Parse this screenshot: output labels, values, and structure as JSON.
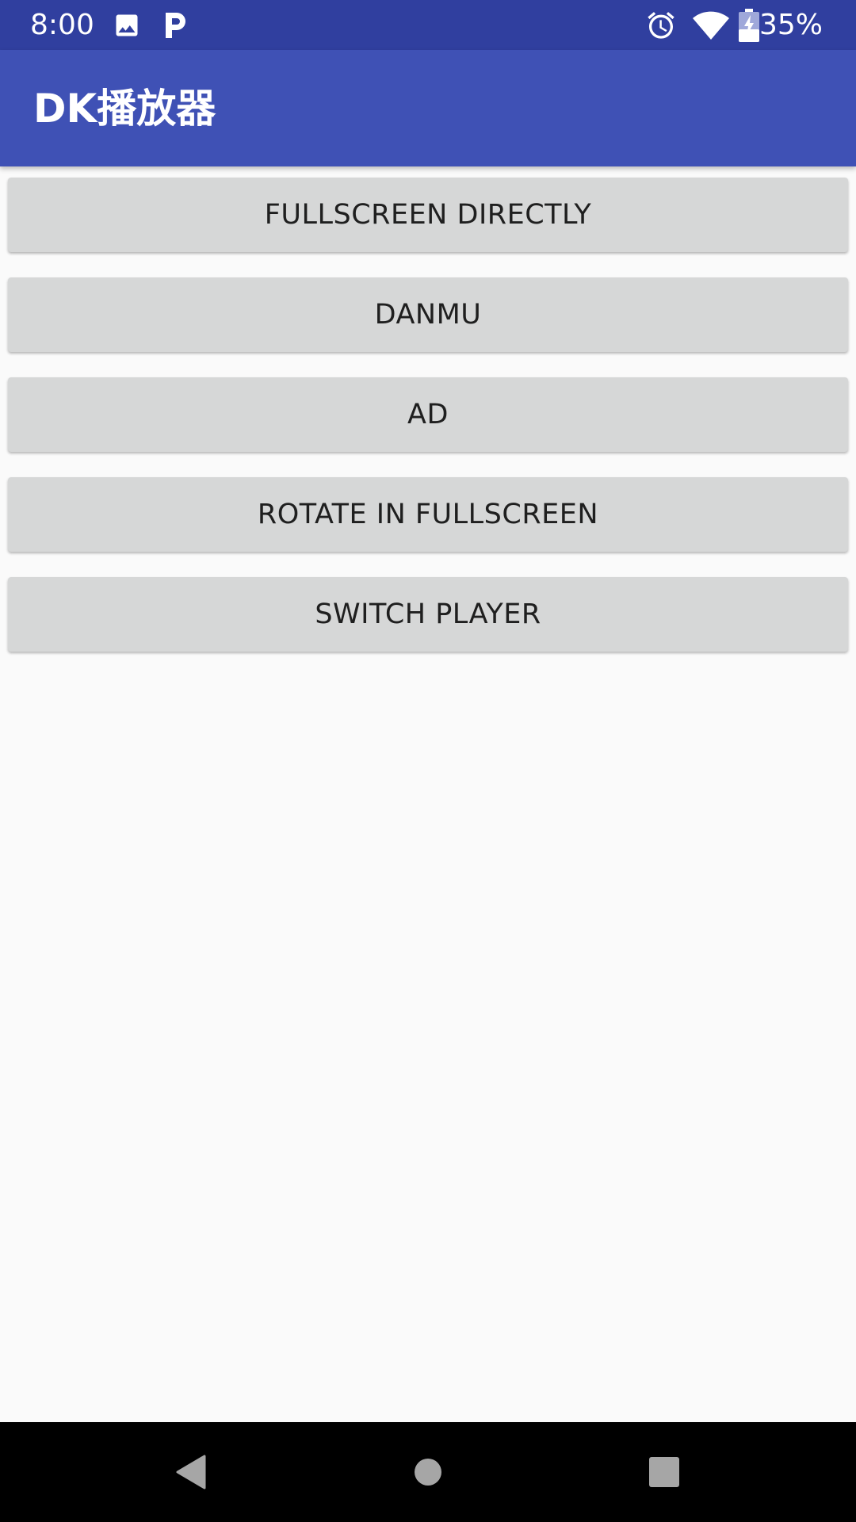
{
  "status_bar": {
    "time": "8:00",
    "battery_percent": "35%",
    "icons": [
      "image-icon",
      "parking-app-icon",
      "alarm-icon",
      "wifi-icon",
      "battery-charging-icon"
    ],
    "background_color": "#303f9f"
  },
  "app_bar": {
    "title": "DK播放器",
    "background_color": "#3f51b5"
  },
  "buttons": [
    {
      "label": "FULLSCREEN DIRECTLY"
    },
    {
      "label": "DANMU"
    },
    {
      "label": "AD"
    },
    {
      "label": "ROTATE IN FULLSCREEN"
    },
    {
      "label": "SWITCH PLAYER"
    }
  ],
  "nav_bar": {
    "items": [
      "back-icon",
      "home-icon",
      "recents-icon"
    ]
  }
}
